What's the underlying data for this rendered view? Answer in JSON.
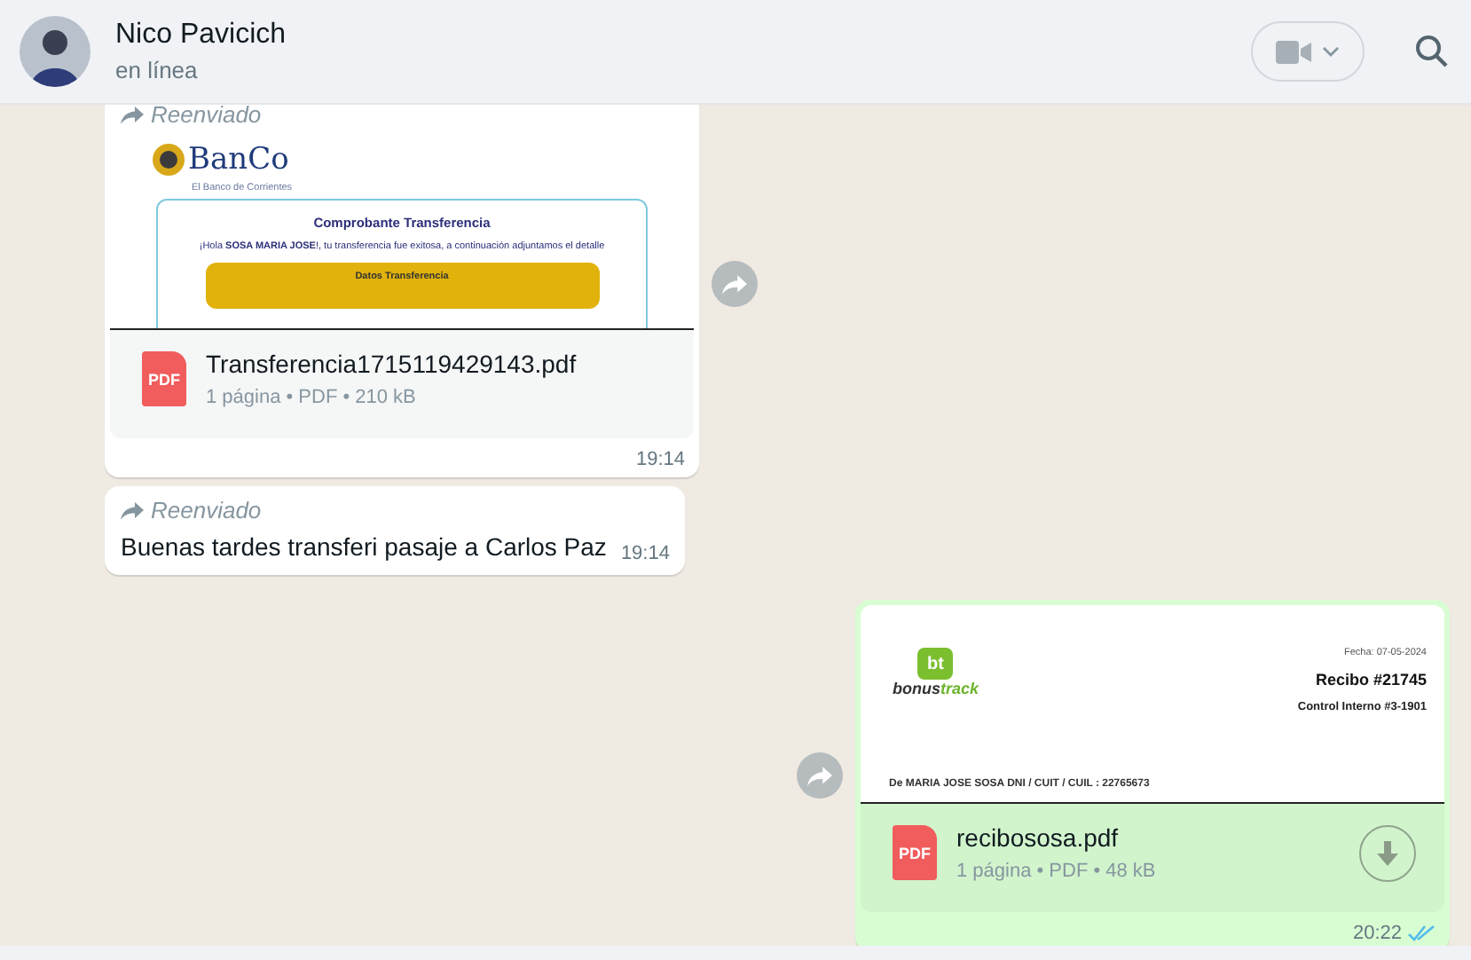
{
  "header": {
    "name": "Nico Pavicich",
    "status": "en línea"
  },
  "messages": [
    {
      "kind": "document",
      "outgoing": false,
      "forwarded": true,
      "forwarded_label": "Reenviado",
      "preview": {
        "kind": "bank",
        "logo": "BanCo",
        "tagline": "El Banco de Corrientes",
        "title": "Comprobante Transferencia",
        "greeting": "¡Hola **SOSA MARIA JOSE**!, tu transferencia fue exitosa, a continuación adjuntamos el detalle",
        "section": "Datos Transferencia"
      },
      "file_icon": "PDF",
      "file_name": "Transferencia1715119429143.pdf",
      "file_meta": "1 página • PDF • 210 kB",
      "downloadable": false,
      "time": "19:14",
      "read": false
    },
    {
      "kind": "text",
      "outgoing": false,
      "forwarded": true,
      "forwarded_label": "Reenviado",
      "text": "Buenas tardes transferi pasaje a Carlos Paz",
      "time": "19:14",
      "read": false
    },
    {
      "kind": "document",
      "outgoing": true,
      "forwarded": false,
      "preview": {
        "kind": "receipt",
        "badge": "bt",
        "logo_a": "bonus",
        "logo_b": "track",
        "date": "Fecha: 07-05-2024",
        "title": "Recibo #21745",
        "control": "Control Interno #3-1901",
        "line": "De MARIA JOSE SOSA DNI / CUIT / CUIL : 22765673"
      },
      "file_icon": "PDF",
      "file_name": "recibososa.pdf",
      "file_meta": "1 página • PDF • 48 kB",
      "downloadable": true,
      "time": "20:22",
      "read": true
    }
  ]
}
